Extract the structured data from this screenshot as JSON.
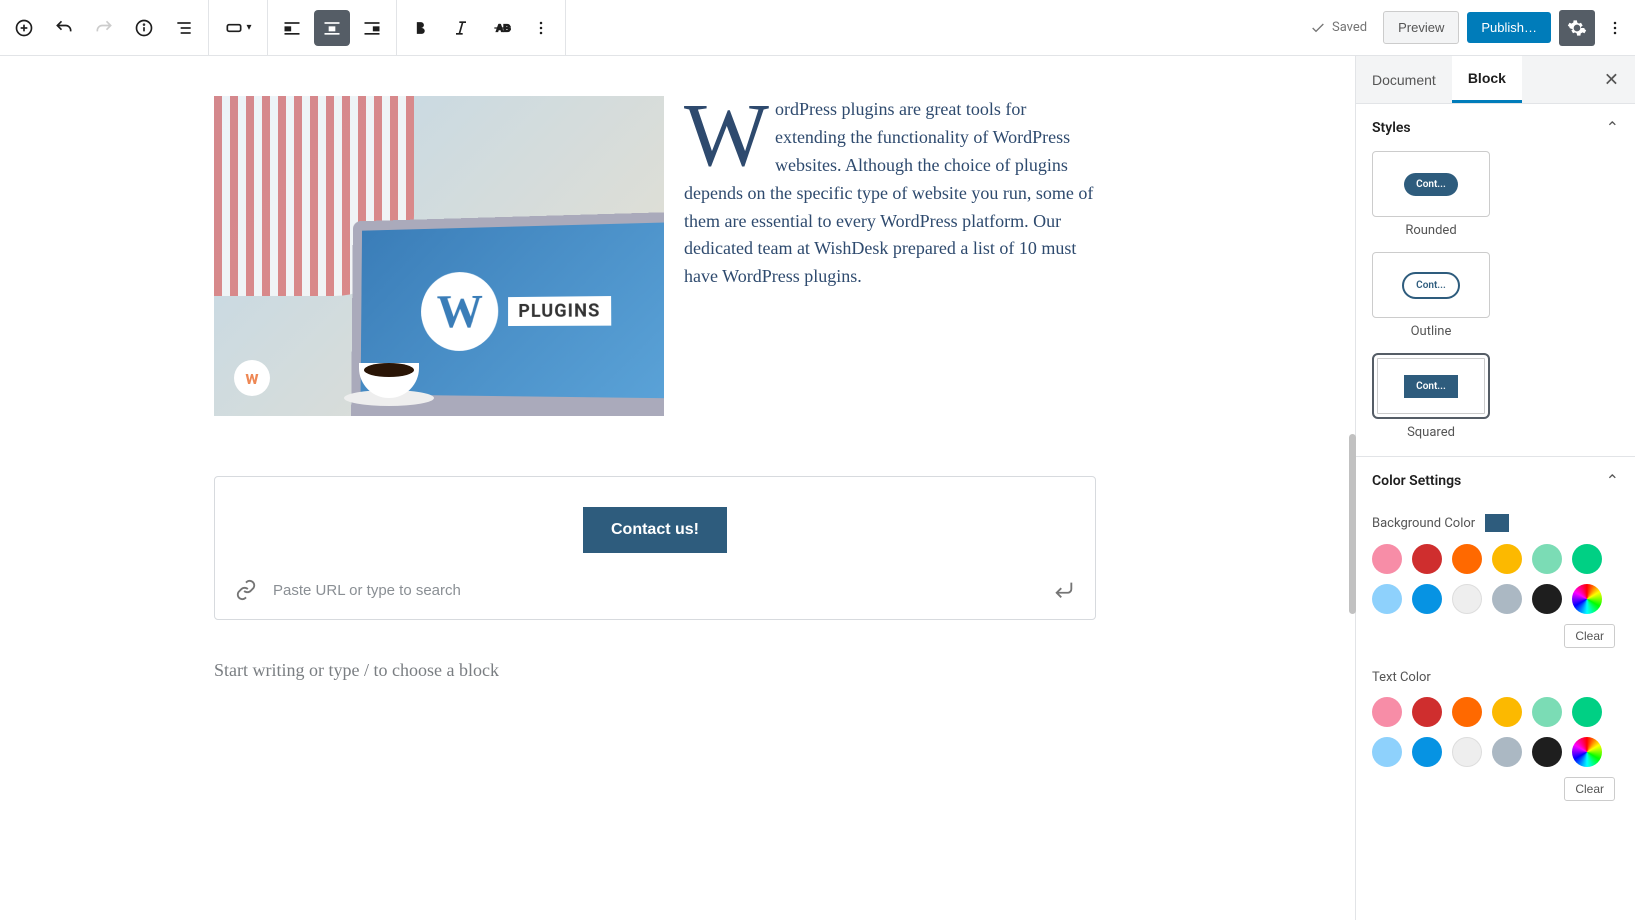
{
  "toolbar": {
    "saved_label": "Saved",
    "preview_label": "Preview",
    "publish_label": "Publish…"
  },
  "content": {
    "dropcap": "W",
    "paragraph": "ordPress plugins are great tools for extending the functionality of WordPress websites. Although the choice of plugins depends on the specific type of website you run, some of them are essential to every WordPress platform. Our dedicated team at WishDesk prepared a list of 10 must have WordPress plugins.",
    "image_plugins_text": "PLUGINS",
    "button_label": "Contact us!",
    "url_placeholder": "Paste URL or type to search",
    "writer_placeholder": "Start writing or type / to choose a block"
  },
  "sidebar": {
    "tabs": {
      "document": "Document",
      "block": "Block"
    },
    "styles": {
      "heading": "Styles",
      "preview_text": "Cont...",
      "options": [
        "Rounded",
        "Outline",
        "Squared"
      ],
      "selected": "Squared"
    },
    "color": {
      "heading": "Color Settings",
      "bg_label": "Background Color",
      "bg_value": "#2e5c7d",
      "text_label": "Text Color",
      "clear_label": "Clear",
      "palette": [
        "#f78da7",
        "#cf2e2e",
        "#ff6900",
        "#fcb900",
        "#7bdcb5",
        "#00d084",
        "#8ed1fc",
        "#0693e3",
        "#eeeeee",
        "#abb8c3"
      ]
    }
  }
}
